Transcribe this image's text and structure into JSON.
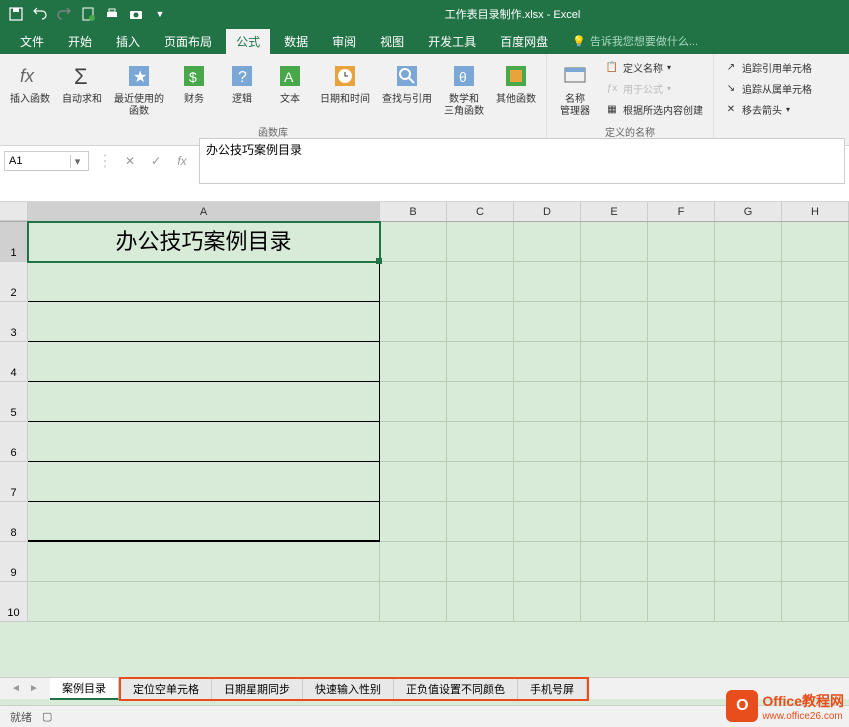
{
  "title": "工作表目录制作.xlsx - Excel",
  "menu": {
    "file": "文件",
    "home": "开始",
    "insert": "插入",
    "layout": "页面布局",
    "formulas": "公式",
    "data": "数据",
    "review": "审阅",
    "view": "视图",
    "dev": "开发工具",
    "baidu": "百度网盘",
    "tellme": "告诉我您想要做什么..."
  },
  "ribbon": {
    "insert_fn": "插入函数",
    "autosum": "自动求和",
    "recent": "最近使用的\n函数",
    "financial": "财务",
    "logical": "逻辑",
    "text": "文本",
    "datetime": "日期和时间",
    "lookup": "查找与引用",
    "math": "数学和\n三角函数",
    "more": "其他函数",
    "lib_label": "函数库",
    "name_mgr": "名称\n管理器",
    "define_name": "定义名称",
    "use_formula": "用于公式",
    "create_sel": "根据所选内容创建",
    "names_label": "定义的名称",
    "trace_prec": "追踪引用单元格",
    "trace_dep": "追踪从属单元格",
    "remove_arrows": "移去箭头"
  },
  "namebox": "A1",
  "formula": "办公技巧案例目录",
  "columns": [
    "A",
    "B",
    "C",
    "D",
    "E",
    "F",
    "G",
    "H"
  ],
  "rows": [
    "1",
    "2",
    "3",
    "4",
    "5",
    "6",
    "7",
    "8",
    "9",
    "10"
  ],
  "cell_a1": "办公技巧案例目录",
  "tabs": {
    "active": "案例目录",
    "t1": "定位空单元格",
    "t2": "日期星期同步",
    "t3": "快速输入性别",
    "t4": "正负值设置不同颜色",
    "t5": "手机号屏"
  },
  "status": {
    "ready": "就绪",
    "accessibility": ""
  },
  "watermark": {
    "title": "Office教程网",
    "url": "www.office26.com"
  }
}
